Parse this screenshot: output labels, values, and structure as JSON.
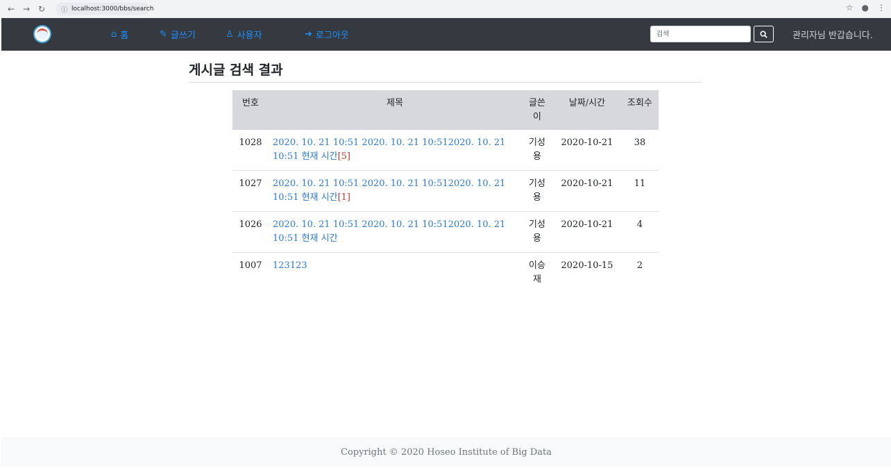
{
  "browser": {
    "url": "localhost:3000/bbs/search"
  },
  "navbar": {
    "home": "홈",
    "write": "글쓰기",
    "users": "사용자",
    "logout": "로그아웃",
    "search_placeholder": "검색",
    "greeting": "관리자님 반갑습니다.",
    "link_color": "#1e90ff",
    "bg_color": "#343a40"
  },
  "page": {
    "title": "게시글 검색 결과"
  },
  "table": {
    "headers": {
      "no": "번호",
      "title": "제목",
      "author": "글쓴이",
      "date": "날짜/시간",
      "views": "조회수"
    },
    "rows": [
      {
        "no": "1028",
        "title": "2020. 10. 21 10:51 2020. 10. 21 10:512020. 10. 21 10:51 현재 시간",
        "comments": "[5]",
        "author": "기성용",
        "date": "2020-10-21",
        "views": "38"
      },
      {
        "no": "1027",
        "title": "2020. 10. 21 10:51 2020. 10. 21 10:512020. 10. 21 10:51 현재 시간",
        "comments": "[1]",
        "author": "기성용",
        "date": "2020-10-21",
        "views": "11"
      },
      {
        "no": "1026",
        "title": "2020. 10. 21 10:51 2020. 10. 21 10:512020. 10. 21 10:51 현재 시간",
        "comments": "",
        "author": "기성용",
        "date": "2020-10-21",
        "views": "4"
      },
      {
        "no": "1007",
        "title": "123123",
        "comments": "",
        "author": "이승재",
        "date": "2020-10-15",
        "views": "2"
      }
    ]
  },
  "footer": {
    "text": "Copyright © 2020 Hoseo Institute of Big Data"
  }
}
